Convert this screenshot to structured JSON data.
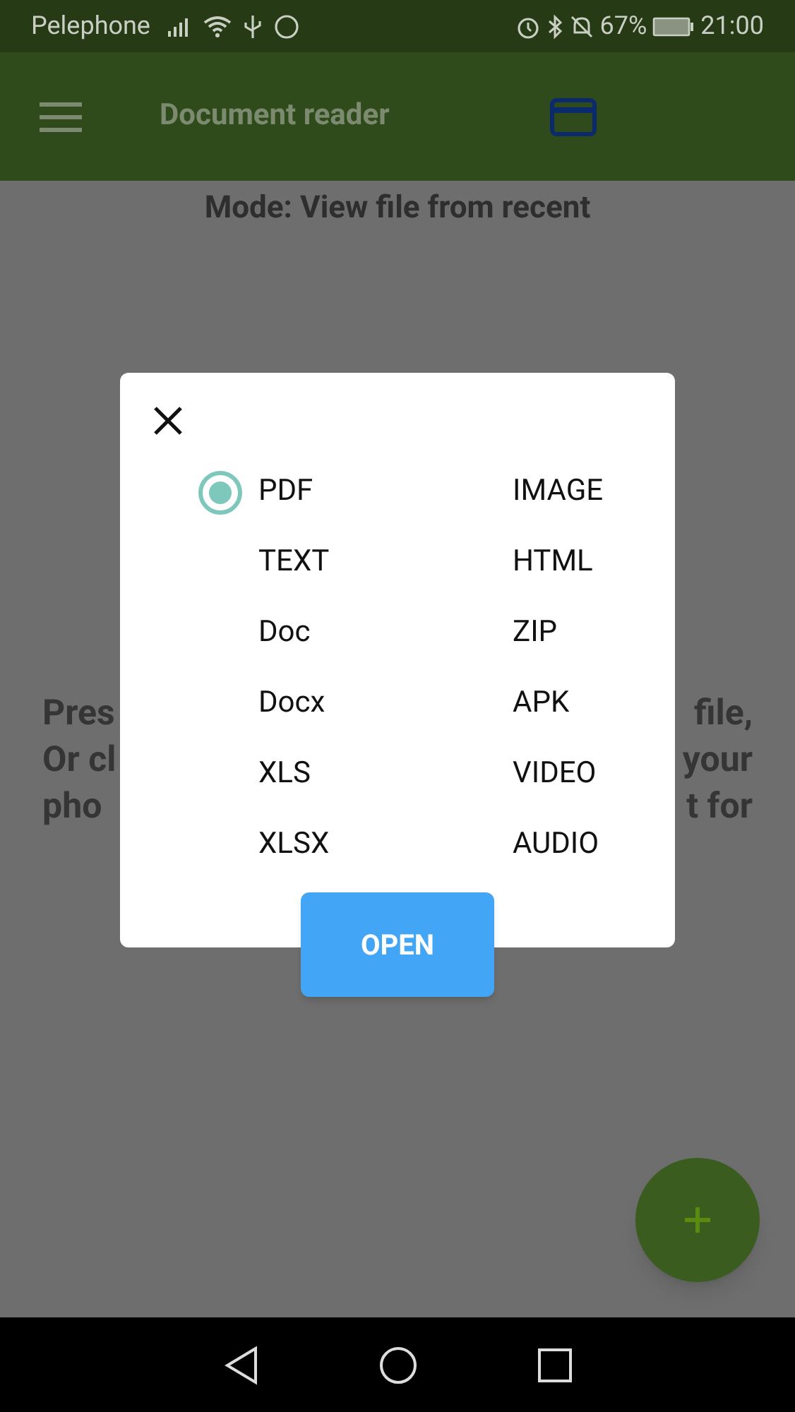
{
  "status_bar": {
    "carrier": "Pelephone",
    "battery": "67%",
    "time": "21:00"
  },
  "app_bar": {
    "title": "Document reader"
  },
  "mode": "Mode: View file from recent",
  "background_lines": [
    {
      "left": "Pres",
      "right": "file,"
    },
    {
      "left": "Or cl",
      "right": "your"
    },
    {
      "left": "pho",
      "right": "t for"
    }
  ],
  "dialog": {
    "options": [
      {
        "label": "PDF",
        "selected": true
      },
      {
        "label": "IMAGE",
        "selected": false
      },
      {
        "label": "TEXT",
        "selected": false
      },
      {
        "label": "HTML",
        "selected": false
      },
      {
        "label": "Doc",
        "selected": false
      },
      {
        "label": "ZIP",
        "selected": false
      },
      {
        "label": "Docx",
        "selected": false
      },
      {
        "label": "APK",
        "selected": false
      },
      {
        "label": "XLS",
        "selected": false
      },
      {
        "label": "VIDEO",
        "selected": false
      },
      {
        "label": "XLSX",
        "selected": false
      },
      {
        "label": "AUDIO",
        "selected": false
      }
    ],
    "button": "OPEN"
  }
}
